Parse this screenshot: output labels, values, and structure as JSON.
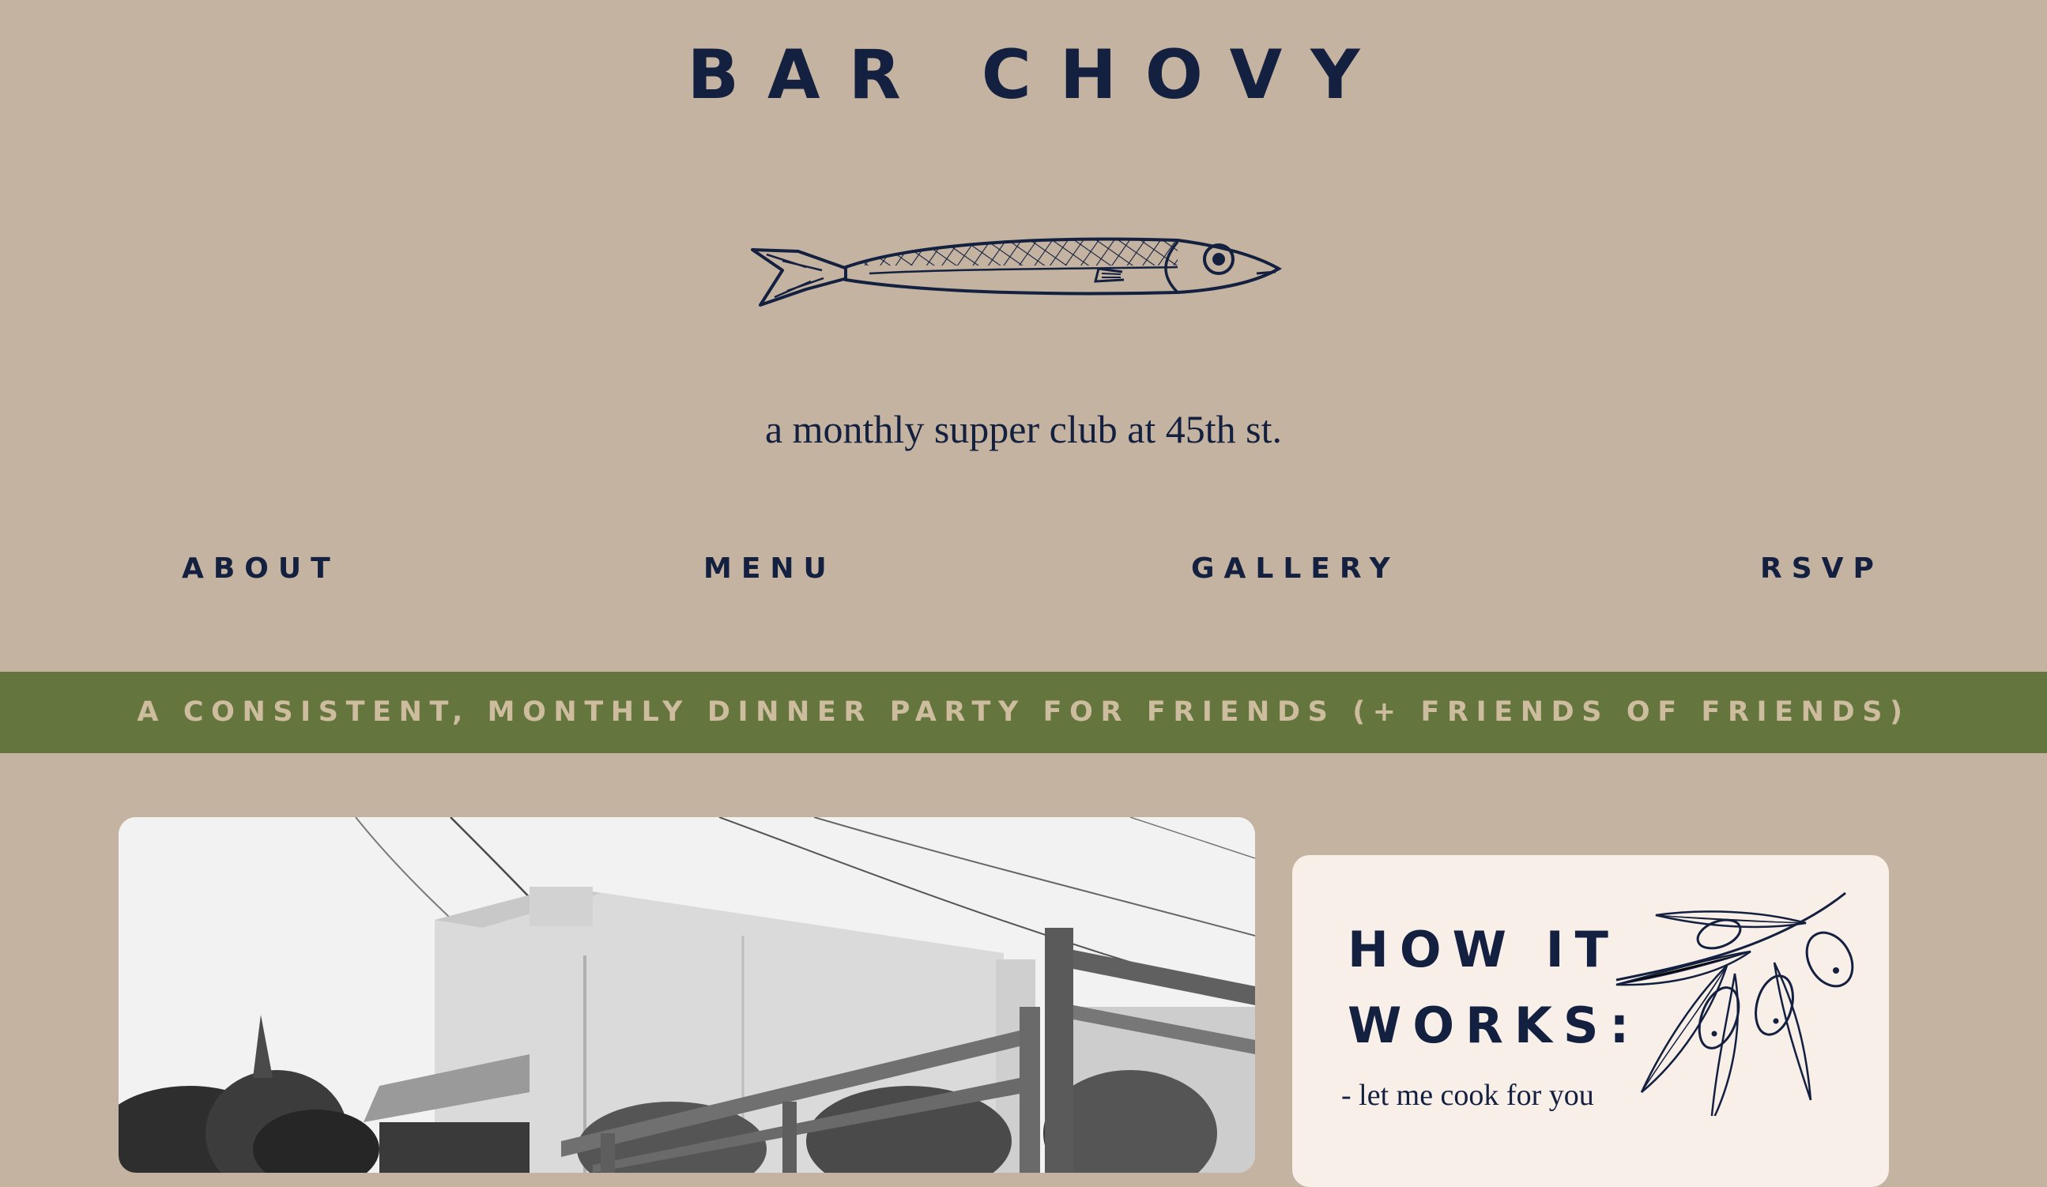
{
  "site": {
    "title": "BAR CHOVY",
    "tagline": "a monthly supper club at 45th st."
  },
  "nav": {
    "items": [
      {
        "label": "ABOUT"
      },
      {
        "label": "MENU"
      },
      {
        "label": "GALLERY"
      },
      {
        "label": "RSVP"
      }
    ]
  },
  "banner": {
    "text": "A CONSISTENT, MONTHLY DINNER PARTY FOR FRIENDS (+ FRIENDS OF FRIENDS)"
  },
  "how_it_works": {
    "title": "HOW IT WORKS:",
    "lines": [
      "- let me cook for you"
    ]
  },
  "icons": {
    "logo": "fish-icon",
    "card_decoration": "olive-branch-icon"
  },
  "colors": {
    "background": "#c4b3a1",
    "navy": "#14203f",
    "banner_green": "#64763d",
    "banner_text": "#cdbd9e",
    "card_background": "#f8efe9"
  }
}
